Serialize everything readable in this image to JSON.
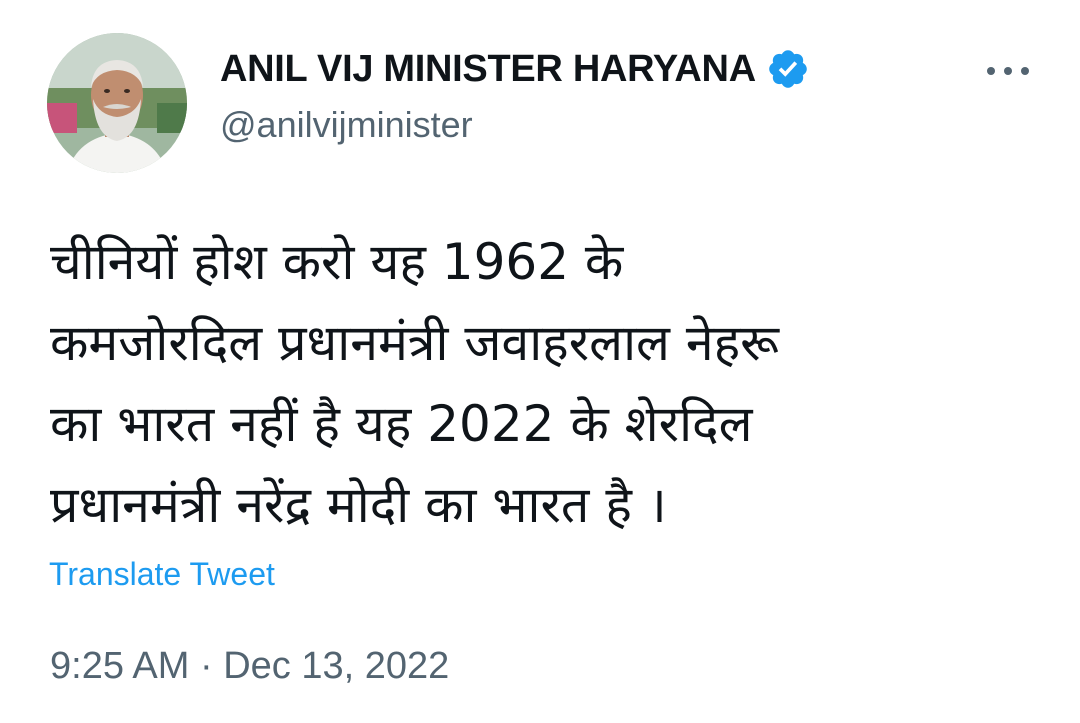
{
  "author": {
    "display_name": "ANIL VIJ MINISTER HARYANA",
    "handle": "@anilvijminister",
    "verified_icon": "verified-badge-icon",
    "avatar_icon": "profile-photo"
  },
  "menu": {
    "more_icon": "more-horizontal-icon"
  },
  "tweet": {
    "lines": [
      "चीनियों होश करो यह 1962 के",
      "कमजोरदिल प्रधानमंत्री जवाहरलाल नेहरू",
      "का भारत नहीं है यह 2022 के शेरदिल",
      "प्रधानमंत्री नरेंद्र मोदी का भारत है ।"
    ],
    "translate_label": "Translate Tweet",
    "time": "9:25 AM",
    "separator": "·",
    "date": "Dec 13, 2022"
  },
  "colors": {
    "text_primary": "#0f1419",
    "text_secondary": "#536471",
    "accent": "#1d9bf0",
    "background": "#ffffff"
  }
}
